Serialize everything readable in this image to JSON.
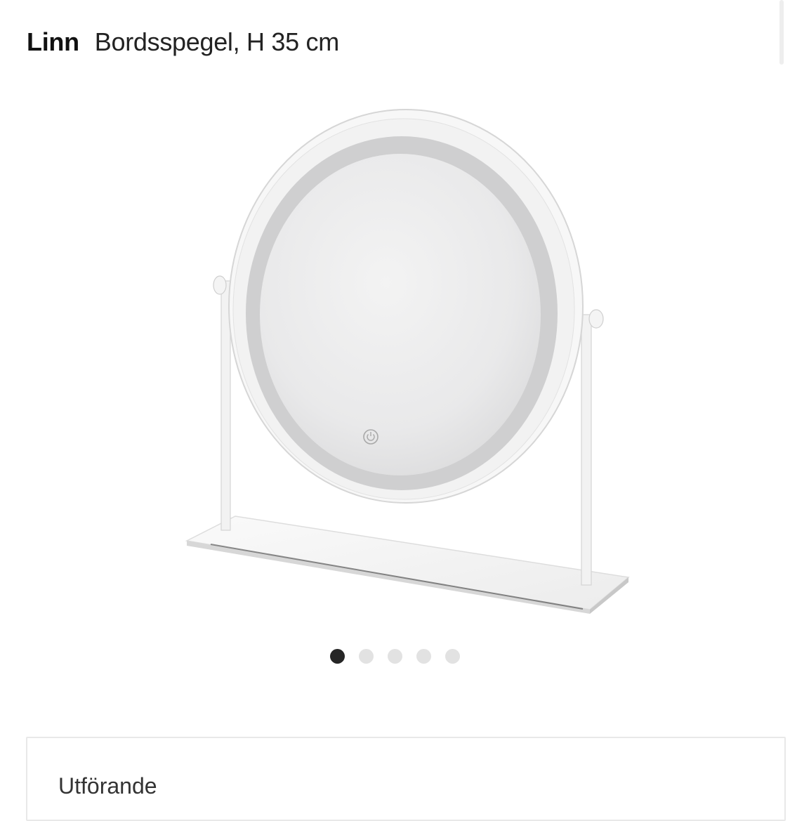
{
  "product": {
    "brand": "Linn",
    "name": "Bordsspegel, H 35 cm"
  },
  "gallery": {
    "image_alt": "Linn Bordsspegel, H 35 cm",
    "image_count": 5,
    "active_index": 0,
    "power_icon": "power-icon"
  },
  "options": {
    "label": "Utförande"
  }
}
